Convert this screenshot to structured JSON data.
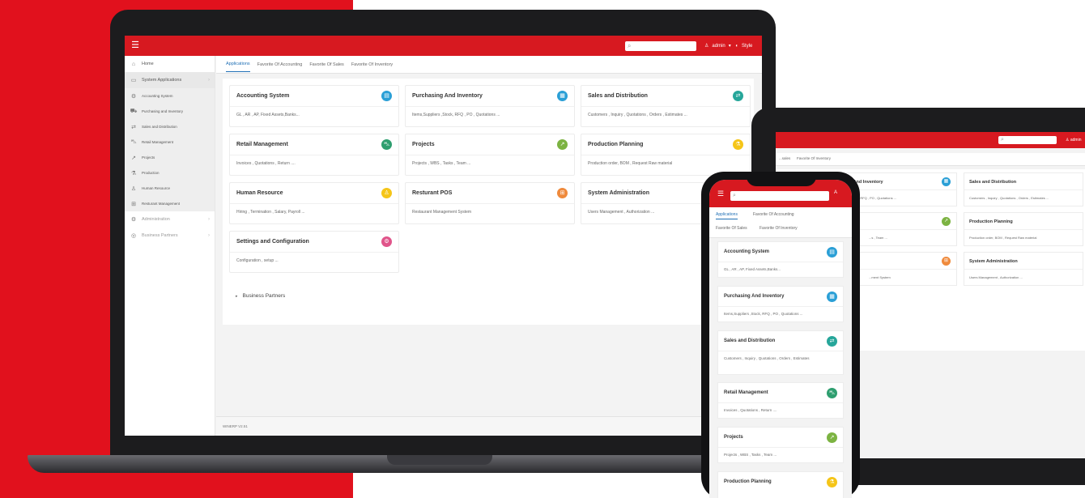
{
  "colors": {
    "brand_red": "#d71920",
    "background_red": "#e1111d",
    "accent_blue": "#1f6fb5",
    "icon_blue": "#2a9fd6",
    "icon_teal": "#26a69a",
    "icon_green": "#2e9e6f",
    "icon_lime": "#7cb342",
    "icon_yellow": "#f5c518",
    "icon_orange": "#ef8a3c",
    "icon_pink": "#e0548a"
  },
  "laptop": {
    "header": {
      "menu_icon": "hamburger-icon",
      "search_placeholder": "",
      "user_label": "admin",
      "theme_label": "Style"
    },
    "sidebar": {
      "items": [
        {
          "label": "Home",
          "icon": "home-icon"
        },
        {
          "label": "System Applications",
          "icon": "apps-icon"
        },
        {
          "label": "Accounting System",
          "icon": "gear-icon"
        },
        {
          "label": "Purchasing and Inventory",
          "icon": "truck-icon"
        },
        {
          "label": "Sales and Distribution",
          "icon": "handshake-icon"
        },
        {
          "label": "Retail Management",
          "icon": "cart-icon"
        },
        {
          "label": "Projects",
          "icon": "chart-icon"
        },
        {
          "label": "Production",
          "icon": "flask-icon"
        },
        {
          "label": "Human Resource",
          "icon": "person-icon"
        },
        {
          "label": "Resturant Management",
          "icon": "restaurant-icon"
        },
        {
          "label": "Administration",
          "icon": "admin-icon"
        },
        {
          "label": "Business Partners",
          "icon": "partners-icon"
        }
      ]
    },
    "tabs": [
      "Applications",
      "Favorite Of Accounting",
      "Favorite Of Sales",
      "Favorite Of Inventory"
    ],
    "cards": [
      {
        "title": "Accounting System",
        "desc": "GL , AR , AP, Fixed Assets,Banks...",
        "icon": "accounting-icon"
      },
      {
        "title": "Purchasing And Inventory",
        "desc": "Items,Suppliers ,Stock, RFQ , PO , Quotations ...",
        "icon": "inventory-icon"
      },
      {
        "title": "Sales and Distribution",
        "desc": "Customers , Inquiry , Quotations , Orders , Estimates ...",
        "icon": "sales-icon"
      },
      {
        "title": "Retail Management",
        "desc": "Invoices , Quotations , Return ....",
        "icon": "retail-icon"
      },
      {
        "title": "Projects",
        "desc": "Projects , WBS , Tasks , Team ...",
        "icon": "projects-icon"
      },
      {
        "title": "Production Planning",
        "desc": "Production order, BOM , Request Raw material",
        "icon": "production-icon"
      },
      {
        "title": "Human Resource",
        "desc": "Hiring , Termination , Salary, Payroll ...",
        "icon": "hr-icon"
      },
      {
        "title": "Resturant POS",
        "desc": "Restaurant Management System",
        "icon": "pos-icon"
      },
      {
        "title": "System Administration",
        "desc": "Users Management , Authorization ...",
        "icon": "admin-icon"
      },
      {
        "title": "Settings and Configuration",
        "desc": "Configuration , setup ...",
        "icon": "settings-icon"
      }
    ],
    "business_partners": "Business Partners",
    "footer_version": "WINERP V2.51"
  },
  "tablet": {
    "search_placeholder": "",
    "user_label": "admin",
    "tabs": [
      "...sales",
      "Favorite Of Inventory"
    ],
    "cards": [
      {
        "title": "...And Inventory",
        "desc": "...RFQ , PO , Quotations ...",
        "icon": "inventory-icon"
      },
      {
        "title": "Sales and Distribution",
        "desc": "Customers , Inquiry , Quotations , Orders , Estimates ...",
        "icon": "sales-icon"
      },
      {
        "title": "",
        "desc": "...s , Team ...",
        "icon": "projects-icon"
      },
      {
        "title": "Production Planning",
        "desc": "Production order, BOM , Request Raw material",
        "icon": "production-icon"
      },
      {
        "title": "",
        "desc": "...ment System",
        "icon": "pos-icon"
      },
      {
        "title": "System Administration",
        "desc": "Users Management , Authorization ...",
        "icon": "admin-icon"
      }
    ]
  },
  "phone": {
    "search_placeholder": "",
    "user_label": "A",
    "tabs": [
      "Applications",
      "Favorite Of Accounting",
      "Favorite Of Sales",
      "Favorite Of Inventory"
    ],
    "cards": [
      {
        "title": "Accounting System",
        "desc": "GL , AR , AP, Fixed Assets,Banks...",
        "icon": "accounting-icon"
      },
      {
        "title": "Purchasing And Inventory",
        "desc": "Items,Suppliers ,Stock, RFQ , PO , Quotations ...",
        "icon": "inventory-icon"
      },
      {
        "title": "Sales and Distribution",
        "desc": "Customers , Inquiry , Quotations , Orders , Estimates",
        "icon": "sales-icon"
      },
      {
        "title": "Retail Management",
        "desc": "Invoices , Quotations , Return ....",
        "icon": "retail-icon"
      },
      {
        "title": "Projects",
        "desc": "Projects , WBS , Tasks , Team ...",
        "icon": "projects-icon"
      },
      {
        "title": "Production Planning",
        "desc": "",
        "icon": "production-icon"
      }
    ]
  }
}
